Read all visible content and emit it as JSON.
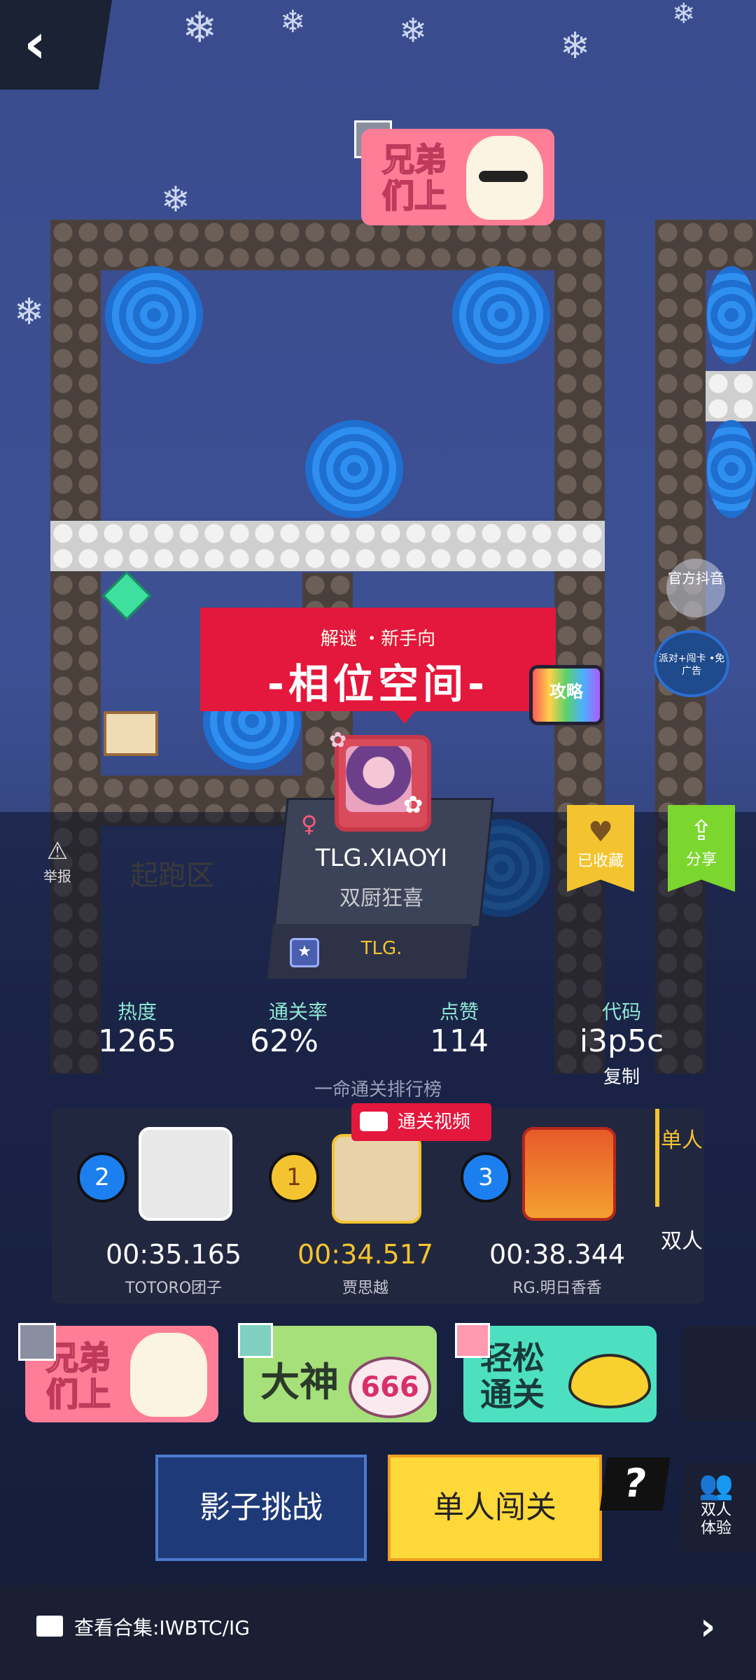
{
  "nav": {
    "back_icon": "chevron-left"
  },
  "sticker_top": {
    "text": "兄弟\n们上"
  },
  "side": {
    "official_label": "官方抖音",
    "promo_label": "派对+闯卡 •免广告",
    "strategy_label": "攻略"
  },
  "level": {
    "genre": "解谜 ・新手向",
    "title": "-相位空间-",
    "start_sign": "起跑区"
  },
  "report": {
    "label": "举报"
  },
  "author": {
    "gender": "♀",
    "name": "TLG.XIAOYI",
    "motto": "双厨狂喜",
    "team": "TLG."
  },
  "actions": {
    "collect_label": "已收藏",
    "share_label": "分享"
  },
  "stats": {
    "heat_label": "热度",
    "heat": "1265",
    "pass_label": "通关率",
    "pass": "62%",
    "like_label": "点赞",
    "like": "114",
    "code_label": "代码",
    "code": "i3p5c",
    "copy_label": "复制"
  },
  "leaderboard": {
    "title": "一命通关排行榜",
    "video_label": "通关视频",
    "tabs": [
      "单人",
      "双人"
    ],
    "entries": [
      {
        "rank": "2",
        "time": "00:35.165",
        "name": "TOTORO团子"
      },
      {
        "rank": "1",
        "time": "00:34.517",
        "name": "贾思越"
      },
      {
        "rank": "3",
        "time": "00:38.344",
        "name": "RG.明日香香"
      }
    ]
  },
  "stickers": [
    "兄弟\n们上",
    "大神",
    "666",
    "轻松\n通关"
  ],
  "buttons": {
    "shadow": "影子挑战",
    "solo": "单人闯关",
    "help": "?",
    "duo": "双人\n体验"
  },
  "footer": {
    "collection": "查看合集:IWBTC/IG"
  },
  "colors": {
    "accent_red": "#e4173c",
    "gold": "#ffd83a",
    "green": "#7bd62e",
    "time_gold": "#f4c430"
  }
}
